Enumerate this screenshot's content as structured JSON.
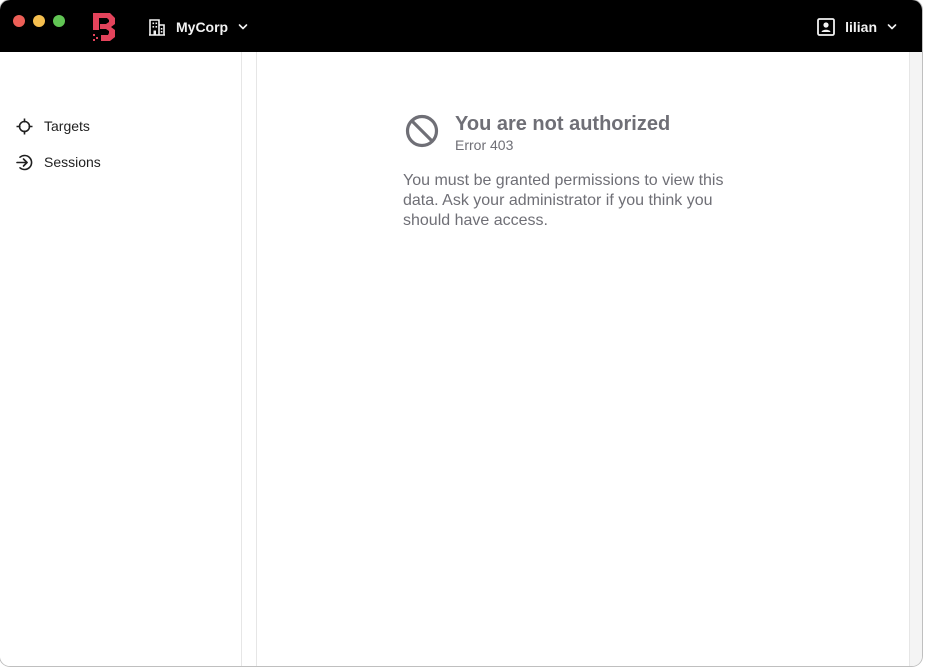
{
  "header": {
    "org": {
      "label": "MyCorp",
      "icon": "building-icon",
      "chevron": "chevron-down-icon"
    },
    "user": {
      "label": "lilian",
      "icon": "user-badge-icon",
      "chevron": "chevron-down-icon"
    },
    "logo": "boundary-logo",
    "colors": {
      "titlebar": "#000000",
      "logo": "#e3435b"
    }
  },
  "sidebar": {
    "items": [
      {
        "label": "Targets",
        "icon": "target-crosshair-icon"
      },
      {
        "label": "Sessions",
        "icon": "sign-in-icon"
      }
    ]
  },
  "error": {
    "icon": "prohibited-icon",
    "title": "You are not authorized",
    "code": "Error 403",
    "message": "You must be granted permissions to view this data. Ask your administrator if you think you should have access.",
    "color": "#6f6f76"
  }
}
